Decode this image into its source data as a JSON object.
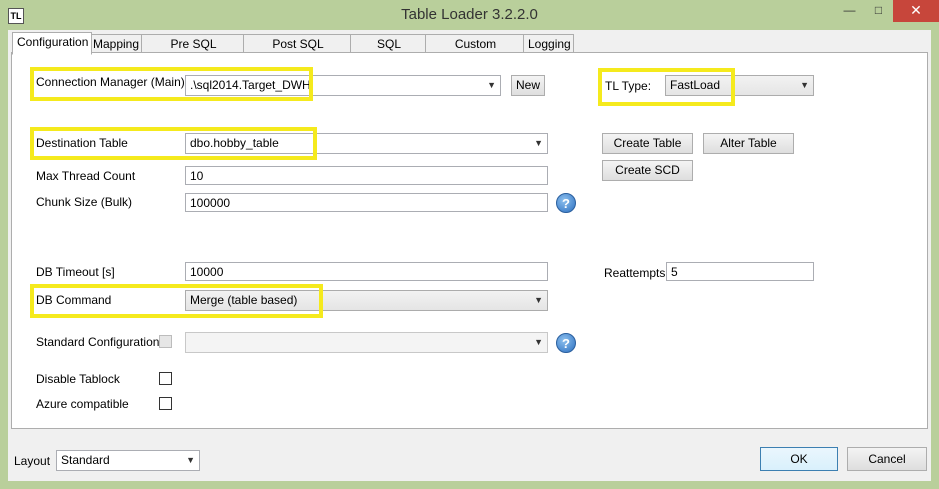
{
  "window": {
    "title": "Table Loader 3.2.2.0",
    "icon_text": "TL"
  },
  "tabs": [
    {
      "label": "Configuration"
    },
    {
      "label": "Mapping"
    },
    {
      "label": "Pre SQL Statement"
    },
    {
      "label": "Post SQL Statement"
    },
    {
      "label": "SQL Preview"
    },
    {
      "label": "Custom Command"
    },
    {
      "label": "Logging"
    }
  ],
  "form": {
    "connection_manager": {
      "label": "Connection Manager (Main):",
      "value": ".\\sql2014.Target_DWH"
    },
    "new_button": "New",
    "tl_type": {
      "label": "TL Type:",
      "value": "FastLoad"
    },
    "destination_table": {
      "label": "Destination Table",
      "value": "dbo.hobby_table"
    },
    "create_table_button": "Create Table",
    "alter_table_button": "Alter Table",
    "create_scd_button": "Create SCD",
    "max_thread_count": {
      "label": "Max Thread Count",
      "value": "10"
    },
    "chunk_size": {
      "label": "Chunk Size (Bulk)",
      "value": "100000"
    },
    "db_timeout": {
      "label": "DB Timeout [s]",
      "value": "10000"
    },
    "reattempts": {
      "label": "Reattempts",
      "value": "5"
    },
    "db_command": {
      "label": "DB Command",
      "value": "Merge (table based)"
    },
    "standard_configuration": {
      "label": "Standard Configuration",
      "value": ""
    },
    "disable_tablock": {
      "label": "Disable Tablock"
    },
    "azure_compatible": {
      "label": "Azure compatible"
    },
    "help_glyph": "?"
  },
  "footer": {
    "layout": {
      "label": "Layout",
      "value": "Standard"
    },
    "ok_button": "OK",
    "cancel_button": "Cancel"
  },
  "colors": {
    "titlebar": "#b9cf9b",
    "highlight": "#f5ea1d",
    "close": "#c7463b"
  }
}
